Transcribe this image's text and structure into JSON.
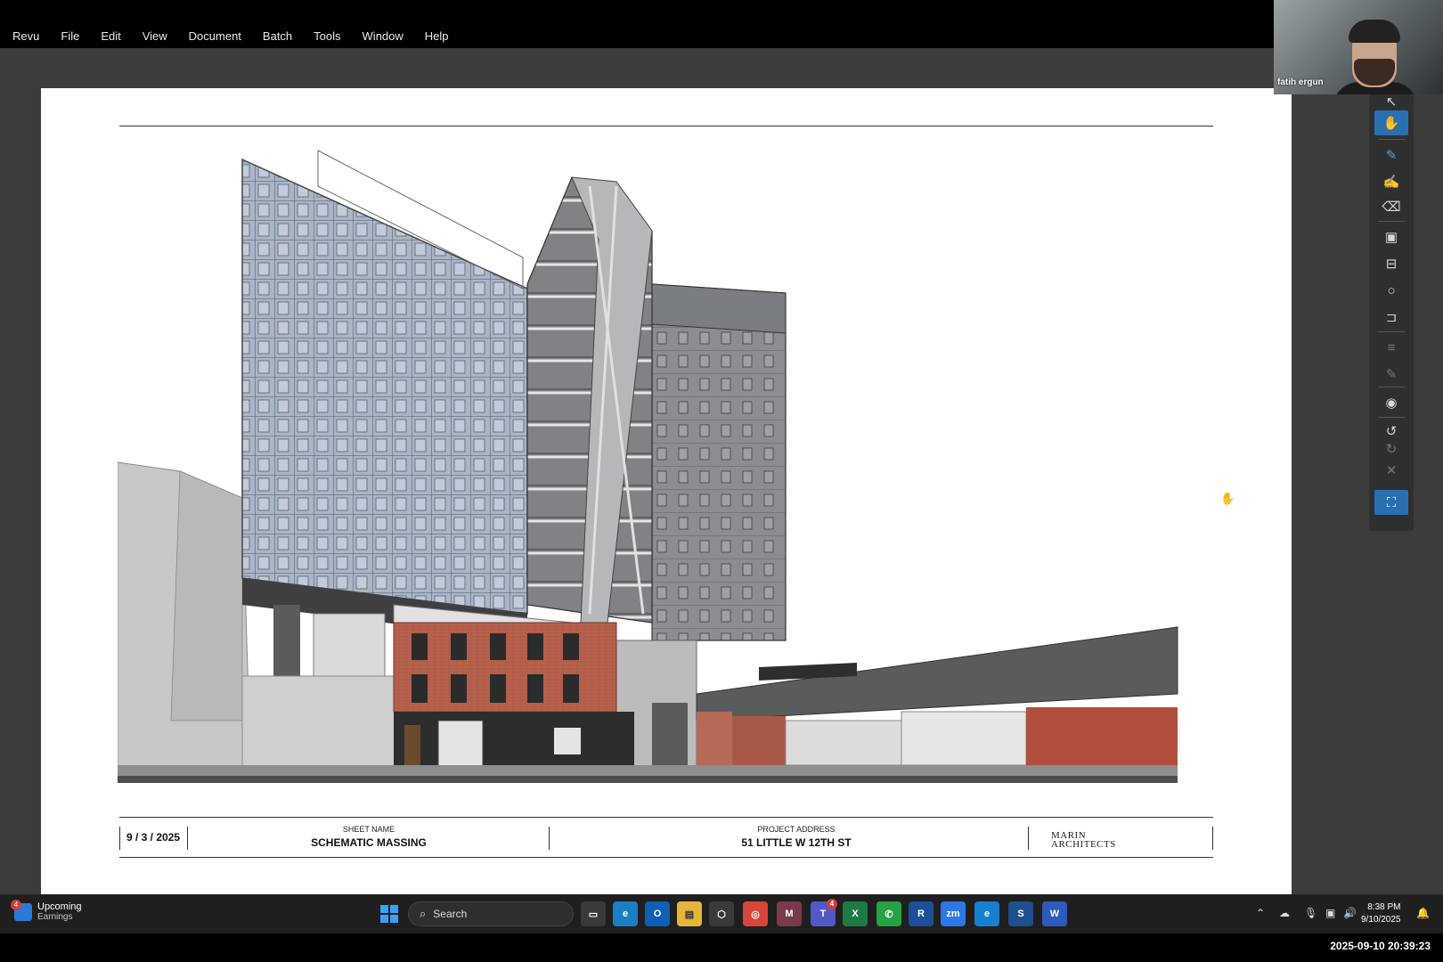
{
  "menubar": {
    "items": [
      "Revu",
      "File",
      "Edit",
      "View",
      "Document",
      "Batch",
      "Tools",
      "Window",
      "Help"
    ]
  },
  "webcam": {
    "name": "fatih ergun"
  },
  "titleblock": {
    "date": "9 / 3 / 2025",
    "sheet_label": "SHEET NAME",
    "sheet_value": "SCHEMATIC MASSING",
    "address_label": "PROJECT ADDRESS",
    "address_value": "51 LITTLE W 12TH ST",
    "logo_line1": "MARIN",
    "logo_line2": "ARCHITECTS"
  },
  "toolbar": {
    "tools": [
      "select-icon",
      "pan-hand-icon",
      "pen-icon",
      "highlighter-icon",
      "eraser-icon",
      "text-box-icon",
      "callout-icon",
      "circle-icon",
      "cloud-icon",
      "line-style-icon",
      "line-color-icon",
      "camera-icon",
      "undo-icon",
      "redo-icon",
      "close-icon",
      "fullscreen-icon"
    ]
  },
  "taskbar": {
    "widget_badge": "4",
    "widget_title": "Upcoming",
    "widget_sub": "Earnings",
    "search_placeholder": "Search",
    "teams_badge": "4",
    "clock_time": "8:38 PM",
    "clock_date": "9/10/2025"
  },
  "overlay": {
    "timestamp": "2025-09-10 20:39:23"
  }
}
